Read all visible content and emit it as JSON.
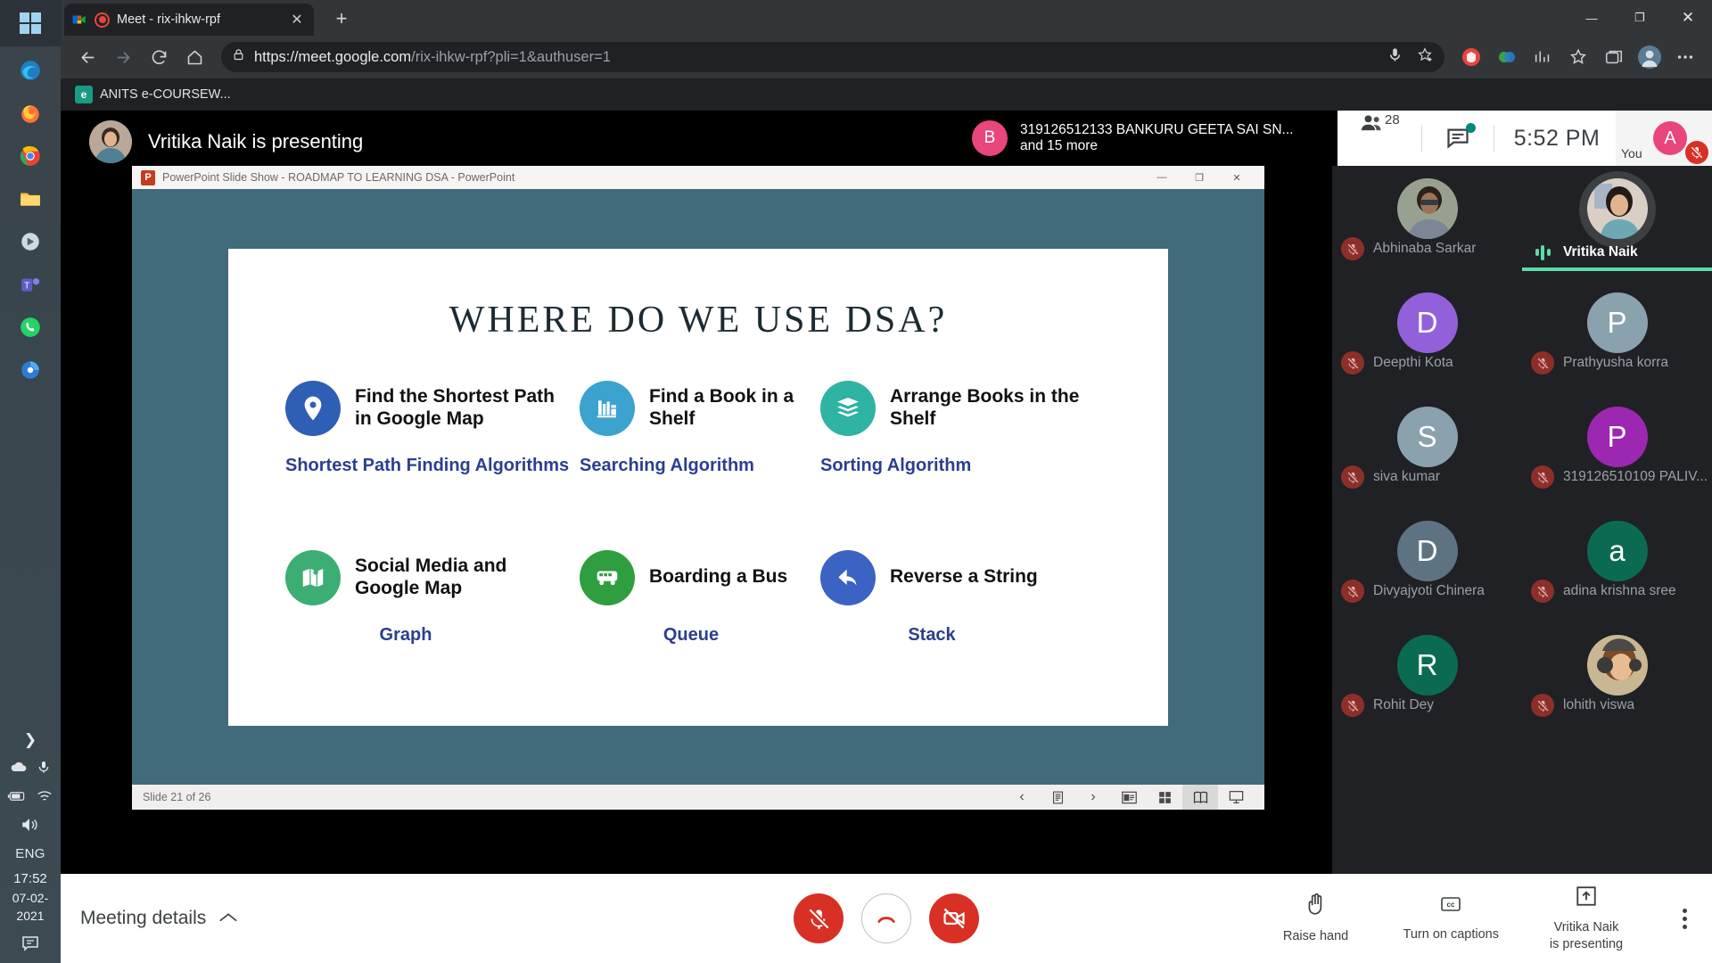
{
  "taskbar": {
    "start_icon": "windows-logo-icon",
    "apps": [
      {
        "name": "edge-icon",
        "color": "#2d8ccd"
      },
      {
        "name": "firefox-icon",
        "color": "#e8671c"
      },
      {
        "name": "chrome-icon",
        "color": "#4285f4"
      },
      {
        "name": "file-explorer-icon",
        "color": "#e8b340"
      },
      {
        "name": "store-icon",
        "color": "#c9d4dd"
      },
      {
        "name": "teams-icon",
        "color": "#5b5fc7"
      },
      {
        "name": "whatsapp-icon",
        "color": "#25d366"
      },
      {
        "name": "media-icon",
        "color": "#2b7cd3"
      }
    ],
    "tray": {
      "expand_icon": "chevron-right-icon",
      "onedrive_icon": "cloud-icon",
      "mic_icon": "microphone-icon",
      "battery_icon": "battery-charging-icon",
      "wifi_icon": "wifi-icon",
      "volume_icon": "speaker-icon",
      "language": "ENG",
      "time": "17:52",
      "date": "07-02-2021",
      "notification_icon": "notification-icon"
    }
  },
  "browser": {
    "tab": {
      "title": "Meet - rix-ihkw-rpf",
      "favicon": "google-meet-icon",
      "recording_icon": "recording-indicator-icon",
      "close_icon": "close-icon"
    },
    "new_tab_label": "+",
    "window_controls": {
      "minimize": "—",
      "maximize": "❐",
      "close": "✕"
    },
    "nav": {
      "back_icon": "back-arrow-icon",
      "forward_icon": "forward-arrow-icon",
      "reload_icon": "reload-icon",
      "home_icon": "home-icon"
    },
    "omnibox": {
      "lock_icon": "lock-icon",
      "url_scheme": "https://meet.google.com",
      "url_path": "/rix-ihkw-rpf?pli=1&authuser=1",
      "mic_icon": "microphone-icon",
      "favorite_icon": "star-add-icon",
      "shield_icon": "tracking-protection-icon",
      "extension_icon": "extension-icon",
      "collections_icon": "collections-icon",
      "favorites_icon": "favorites-icon",
      "tabs_icon": "tab-list-icon",
      "profile_icon": "profile-avatar-icon",
      "settings_icon": "more-options-icon"
    },
    "bookmark": {
      "label": "ANITS e-COURSEW...",
      "icon": "bookmark-site-icon"
    }
  },
  "meet": {
    "header": {
      "presenter_text": "Vritika Naik is presenting",
      "presenter_avatar": "vritika-avatar",
      "toast": {
        "initial": "B",
        "line1": "319126512133 BANKURU GEETA SAI SN...",
        "line2": "and 15 more"
      },
      "people_icon": "people-icon",
      "people_count": "28",
      "chat_icon": "chat-icon",
      "chat_has_unread": true,
      "time": "5:52  PM",
      "you_label": "You",
      "you_initial": "A",
      "you_muted_icon": "mic-off-icon"
    },
    "shared_window": {
      "app_icon": "powerpoint-icon",
      "title": "PowerPoint Slide Show  -  ROADMAP TO LEARNING DSA  -  PowerPoint",
      "window_controls": {
        "minimize": "—",
        "restore": "❐",
        "close": "✕"
      },
      "status_text": "Slide 21 of 26",
      "view_buttons": [
        {
          "name": "previous-slide-button",
          "icon": "‹"
        },
        {
          "name": "slide-menu-button",
          "icon": "slide-list-icon"
        },
        {
          "name": "next-slide-button",
          "icon": "›"
        },
        {
          "name": "normal-view-button",
          "icon": "normal-view-icon"
        },
        {
          "name": "slide-sorter-button",
          "icon": "grid-view-icon"
        },
        {
          "name": "reading-view-button",
          "icon": "reading-view-icon",
          "active": true
        },
        {
          "name": "slide-show-button",
          "icon": "slideshow-icon"
        }
      ]
    },
    "slide": {
      "title": "WHERE DO WE USE DSA?",
      "items": [
        {
          "label": "Find the Shortest Path in Google Map",
          "sublabel": "Shortest Path Finding Algorithms",
          "color": "#2f5fb5",
          "icon": "map-pin-icon"
        },
        {
          "label": "Find a Book in a Shelf",
          "sublabel": "Searching Algorithm",
          "color": "#3ba3cd",
          "icon": "books-shelf-icon"
        },
        {
          "label": "Arrange Books in the Shelf",
          "sublabel": "Sorting Algorithm",
          "color": "#2fb3a3",
          "icon": "stacked-books-icon"
        },
        {
          "label": "Social Media and Google Map",
          "sublabel": "Graph",
          "color": "#3cae74",
          "icon": "folded-map-icon"
        },
        {
          "label": "Boarding a Bus",
          "sublabel": "Queue",
          "color": "#2f9e3f",
          "icon": "bus-icon"
        },
        {
          "label": "Reverse a String",
          "sublabel": "Stack",
          "color": "#3b63c4",
          "icon": "reply-arrow-icon"
        }
      ]
    },
    "participants": [
      {
        "name": "Abhinaba Sarkar",
        "type": "photo",
        "photo": "man-glasses",
        "muted": true,
        "speaking": false
      },
      {
        "name": "Vritika Naik",
        "type": "photo",
        "photo": "woman-smiling",
        "muted": false,
        "speaking": true
      },
      {
        "name": "Deepthi Kota",
        "type": "initial",
        "initial": "D",
        "color": "#9260db",
        "muted": true,
        "speaking": false
      },
      {
        "name": "Prathyusha korra",
        "type": "initial",
        "initial": "P",
        "color": "#8aa2ae",
        "muted": true,
        "speaking": false
      },
      {
        "name": "siva kumar",
        "type": "initial",
        "initial": "S",
        "color": "#8aa2ae",
        "muted": true,
        "speaking": false
      },
      {
        "name": "319126510109 PALIV...",
        "type": "initial",
        "initial": "P",
        "color": "#9c27b0",
        "muted": true,
        "speaking": false
      },
      {
        "name": "Divyajyoti Chinera",
        "type": "initial",
        "initial": "D",
        "color": "#5d7382",
        "muted": true,
        "speaking": false
      },
      {
        "name": "adina krishna sree",
        "type": "initial",
        "initial": "a",
        "color": "#0b6b52",
        "muted": true,
        "speaking": false
      },
      {
        "name": "Rohit Dey",
        "type": "initial",
        "initial": "R",
        "color": "#0b6b52",
        "muted": true,
        "speaking": false
      },
      {
        "name": "lohith viswa",
        "type": "photo",
        "photo": "child-headphones",
        "muted": true,
        "speaking": false
      }
    ],
    "footer": {
      "meeting_details": "Meeting details",
      "meeting_details_icon": "chevron-up-icon",
      "mic_button": {
        "name": "mic-off-button",
        "icon": "mic-off-icon",
        "state": "muted"
      },
      "hangup_button": {
        "name": "leave-call-button",
        "icon": "phone-hangup-icon"
      },
      "camera_button": {
        "name": "camera-off-button",
        "icon": "video-off-icon",
        "state": "off"
      },
      "raise_hand": {
        "label": "Raise hand",
        "icon": "raise-hand-icon"
      },
      "captions": {
        "label": "Turn on captions",
        "icon": "closed-captions-icon"
      },
      "present": {
        "label_line1": "Vritika Naik",
        "label_line2": "is presenting",
        "icon": "present-screen-icon"
      },
      "more_options_icon": "more-vertical-icon"
    }
  }
}
